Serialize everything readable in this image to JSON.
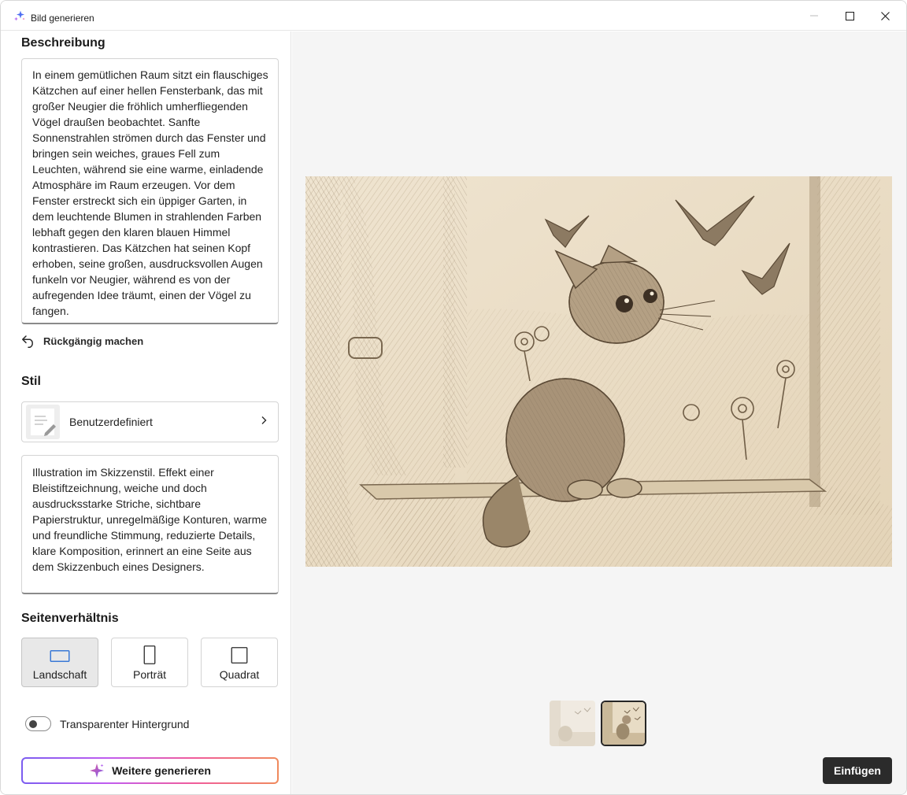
{
  "window": {
    "title": "Bild generieren",
    "accent_color": "#7b5cf0"
  },
  "description": {
    "heading": "Beschreibung",
    "text": "In einem gemütlichen Raum sitzt ein flauschiges Kätzchen auf einer hellen Fensterbank, das mit großer Neugier die fröhlich umherfliegenden Vögel draußen beobachtet. Sanfte Sonnenstrahlen strömen durch das Fenster und bringen sein weiches, graues Fell zum Leuchten, während sie eine warme, einladende Atmosphäre im Raum erzeugen. Vor dem Fenster erstreckt sich ein üppiger Garten, in dem leuchtende Blumen in strahlenden Farben lebhaft gegen den klaren blauen Himmel kontrastieren. Das Kätzchen hat seinen Kopf erhoben, seine großen, ausdrucksvollen Augen funkeln vor Neugier, während es von der aufregenden Idee träumt, einen der Vögel zu fangen.",
    "undo_label": "Rückgängig machen",
    "undo_icon": "undo-arrow-icon"
  },
  "style": {
    "heading": "Stil",
    "selected_label": "Benutzerdefiniert",
    "thumb_icon": "pencil-notes-icon",
    "prompt_text": "Illustration im Skizzenstil. Effekt einer Bleistiftzeichnung, weiche und doch ausdrucksstarke Striche, sichtbare Papierstruktur, unregelmäßige Konturen, warme und freundliche Stimmung, reduzierte Details, klare Komposition, erinnert an eine Seite aus dem Skizzenbuch eines Designers."
  },
  "aspect_ratio": {
    "heading": "Seitenverhältnis",
    "selected": "Landschaft",
    "options": [
      {
        "label": "Landschaft",
        "icon": "landscape-rect-icon"
      },
      {
        "label": "Porträt",
        "icon": "portrait-rect-icon"
      },
      {
        "label": "Quadrat",
        "icon": "square-icon"
      }
    ]
  },
  "transparent_background": {
    "label": "Transparenter Hintergrund",
    "enabled": false
  },
  "generate_button": {
    "label": "Weitere generieren",
    "icon": "sparkle-icon"
  },
  "preview": {
    "image": "sketch-kitten-window-birds",
    "thumbnails_count": 2,
    "selected_thumbnail": 2
  },
  "insert_button": {
    "label": "Einfügen"
  }
}
